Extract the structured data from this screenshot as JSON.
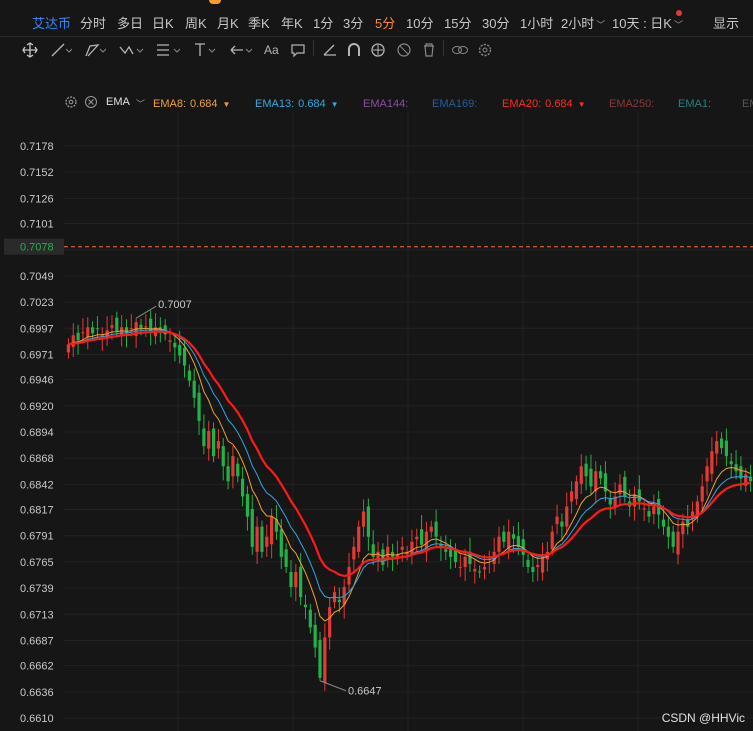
{
  "tabs": [
    {
      "label": "艾达币",
      "kind": "symbol"
    },
    {
      "label": "分时"
    },
    {
      "label": "多日"
    },
    {
      "label": "日K"
    },
    {
      "label": "周K"
    },
    {
      "label": "月K"
    },
    {
      "label": "季K"
    },
    {
      "label": "年K"
    },
    {
      "label": "1分"
    },
    {
      "label": "3分"
    },
    {
      "label": "5分",
      "kind": "active"
    },
    {
      "label": "10分"
    },
    {
      "label": "15分"
    },
    {
      "label": "30分"
    },
    {
      "label": "1小时"
    },
    {
      "label": "2小时",
      "dropdown": true
    },
    {
      "label": "10天 : 日K",
      "dropdown": true
    },
    {
      "label": "显示"
    }
  ],
  "toolbar": {
    "tools": [
      "crosshair-icon",
      "line-icon",
      "polyline-icon",
      "wave-icon",
      "fib-icon",
      "vertical-line-icon",
      "arrow-icon",
      "text-icon",
      "note-icon",
      "angle-icon",
      "magnet-icon",
      "sync-icon",
      "hide-icon",
      "trash-icon",
      "eye-link-icon",
      "settings-icon"
    ],
    "text_tool_label": "Aa"
  },
  "ema_legend": {
    "name": "EMA",
    "items": [
      {
        "label": "EMA8:",
        "value": "0.684",
        "color": "#f0a030"
      },
      {
        "label": "EMA13:",
        "value": "0.684",
        "color": "#2fa8e0"
      },
      {
        "label": "EMA144:",
        "value": "",
        "color": "#8a4fa0"
      },
      {
        "label": "EMA169:",
        "value": "",
        "color": "#2a5c9a"
      },
      {
        "label": "EMA20:",
        "value": "0.684",
        "color": "#ff2a2a"
      },
      {
        "label": "EMA250:",
        "value": "",
        "color": "#8a3a3a"
      },
      {
        "label": "EMA1:",
        "value": "",
        "color": "#2a8080"
      },
      {
        "label": "EMA",
        "value": "",
        "color": "#555555"
      }
    ]
  },
  "chart_data": {
    "type": "candlestick",
    "title": "",
    "ylim": [
      0.661,
      0.7178
    ],
    "y_ticks": [
      "0.7178",
      "0.7152",
      "0.7126",
      "0.7101",
      "0.7075",
      "0.7049",
      "0.7023",
      "0.6997",
      "0.6971",
      "0.6946",
      "0.6920",
      "0.6894",
      "0.6868",
      "0.6842",
      "0.6817",
      "0.6791",
      "0.6765",
      "0.6739",
      "0.6713",
      "0.6687",
      "0.6662",
      "0.6636",
      "0.6610"
    ],
    "current_price": "0.7078",
    "annotations": [
      {
        "text": "0.7007",
        "value": 0.7007,
        "type": "high"
      },
      {
        "text": "0.6647",
        "value": 0.6647,
        "type": "low"
      }
    ],
    "colors": {
      "up": "#e53935",
      "down": "#21b24a",
      "ema8": "#f0a030",
      "ema13": "#2fa8e0",
      "ema20": "#ff1a1a",
      "price_line": "#ff6a3a",
      "price_label_bg": "#2a2a2a",
      "price_label_text": "#21b24a"
    },
    "closes": [
      0.6981,
      0.699,
      0.6985,
      0.6993,
      0.6998,
      0.6992,
      0.6996,
      0.699,
      0.6995,
      0.7,
      0.6994,
      0.6998,
      0.6992,
      0.6997,
      0.7003,
      0.6996,
      0.6999,
      0.6994,
      0.6998,
      0.6995,
      0.6991,
      0.6985,
      0.6978,
      0.697,
      0.696,
      0.6945,
      0.6928,
      0.6905,
      0.688,
      0.6895,
      0.687,
      0.6885,
      0.686,
      0.6845,
      0.687,
      0.685,
      0.683,
      0.681,
      0.678,
      0.68,
      0.6775,
      0.679,
      0.681,
      0.6795,
      0.677,
      0.676,
      0.674,
      0.6755,
      0.673,
      0.672,
      0.67,
      0.668,
      0.665,
      0.669,
      0.672,
      0.6735,
      0.6725,
      0.674,
      0.676,
      0.678,
      0.68,
      0.6815,
      0.679,
      0.677,
      0.6775,
      0.6762,
      0.678,
      0.677,
      0.6772,
      0.678,
      0.6775,
      0.6785,
      0.679,
      0.6782,
      0.6795,
      0.68,
      0.679,
      0.678,
      0.6775,
      0.677,
      0.6765,
      0.676,
      0.677,
      0.6763,
      0.6758,
      0.6755,
      0.676,
      0.6768,
      0.6775,
      0.679,
      0.6785,
      0.6795,
      0.6788,
      0.678,
      0.6772,
      0.676,
      0.6755,
      0.6762,
      0.677,
      0.6775,
      0.6795,
      0.681,
      0.68,
      0.682,
      0.6835,
      0.6845,
      0.686,
      0.685,
      0.684,
      0.6855,
      0.6848,
      0.6835,
      0.6822,
      0.683,
      0.6842,
      0.683,
      0.682,
      0.6832,
      0.6825,
      0.6818,
      0.681,
      0.682,
      0.6812,
      0.68,
      0.679,
      0.678,
      0.6795,
      0.6805,
      0.68,
      0.6815,
      0.6825,
      0.684,
      0.686,
      0.6875,
      0.6885,
      0.6878,
      0.687,
      0.6862,
      0.6855,
      0.6848,
      0.6852,
      0.6845
    ]
  },
  "watermark": "CSDN @HHVic"
}
